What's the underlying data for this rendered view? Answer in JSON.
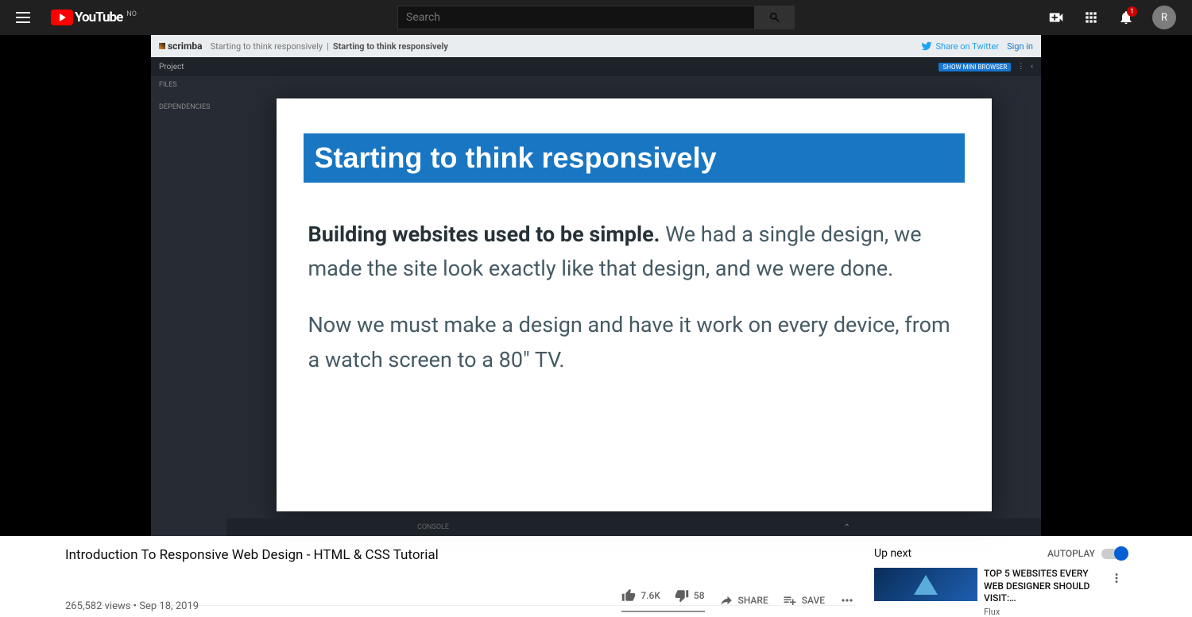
{
  "header": {
    "brand": "YouTube",
    "countryCode": "NO",
    "searchPlaceholder": "Search",
    "notificationCount": "1",
    "avatarLetter": "R"
  },
  "player": {
    "scrimbaBrand": "scrimba",
    "breadcrumbParent": "Starting to think responsively",
    "breadcrumbActive": "Starting to think responsively",
    "shareTwitter": "Share on Twitter",
    "signIn": "Sign in",
    "projBar": {
      "left": "Project",
      "showBrowser": "SHOW MINI BROWSER"
    },
    "sidebar": {
      "files": "FILES",
      "deps": "DEPENDENCIES"
    },
    "console": "CONSOLE",
    "slide": {
      "title": "Starting to think responsively",
      "p1_strong": "Building websites used to be simple.",
      "p1_rest": " We had a single design, we made the site look exactly like that design, and we were done.",
      "p2": "Now we must make a design and have it work on every device, from a watch screen to a 80\" TV."
    }
  },
  "video": {
    "title": "Introduction To Responsive Web Design - HTML & CSS Tutorial",
    "views": "265,582 views",
    "date": "Sep 18, 2019",
    "likes": "7.6K",
    "dislikes": "58",
    "share": "SHARE",
    "save": "SAVE"
  },
  "sidebar": {
    "upNext": "Up next",
    "autoplay": "AUTOPLAY",
    "next": {
      "title": "TOP 5 WEBSITES EVERY WEB DESIGNER SHOULD VISIT:…",
      "channel": "Flux"
    }
  }
}
